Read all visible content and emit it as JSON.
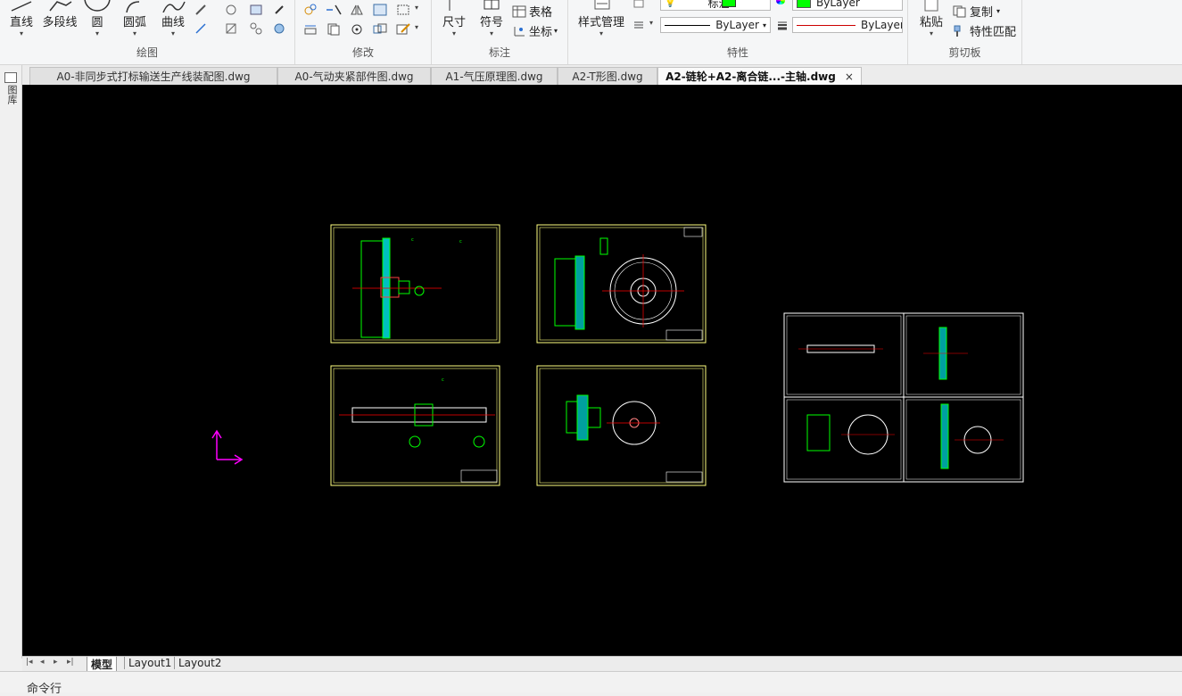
{
  "ribbon": {
    "draw_panel": {
      "label": "绘图",
      "tools": {
        "line": "直线",
        "polyline": "多段线",
        "circle": "圆",
        "arc": "圆弧",
        "curve": "曲线"
      }
    },
    "modify_panel": {
      "label": "修改"
    },
    "annotate_panel": {
      "label": "标注",
      "tools": {
        "dimension": "尺寸",
        "symbol": "符号",
        "table": "表格",
        "coordinate": "坐标"
      }
    },
    "properties_panel": {
      "label": "特性",
      "style_manager": "样式管理",
      "layer_value": "标注",
      "color_value": "ByLayer",
      "linetype_value": "ByLayer",
      "lineweight_value": "ByLayer",
      "color_green": "#00ff00"
    },
    "clipboard_panel": {
      "label": "剪切板",
      "paste": "粘贴",
      "copy": "复制",
      "match_properties": "特性匹配"
    }
  },
  "doc_tabs": [
    {
      "label": "A0-非同步式打标输送生产线装配图.dwg",
      "active": false
    },
    {
      "label": "A0-气动夹紧部件图.dwg",
      "active": false
    },
    {
      "label": "A1-气压原理图.dwg",
      "active": false
    },
    {
      "label": "A2-T形图.dwg",
      "active": false
    },
    {
      "label": "A2-链轮+A2-离合链...-主轴.dwg",
      "active": true
    }
  ],
  "close_glyph": "×",
  "left_strip": {
    "label": "图库"
  },
  "layout_tabs": [
    "模型",
    "Layout1",
    "Layout2"
  ],
  "command_line": {
    "label": "命令行"
  },
  "colors": {
    "canvas_bg": "#000000",
    "frame_yellow": "#ffff80",
    "ucs_magenta": "#ff00ff",
    "drawing_green": "#00ff00",
    "center_red": "#ff0000",
    "cyan": "#00ffff"
  }
}
